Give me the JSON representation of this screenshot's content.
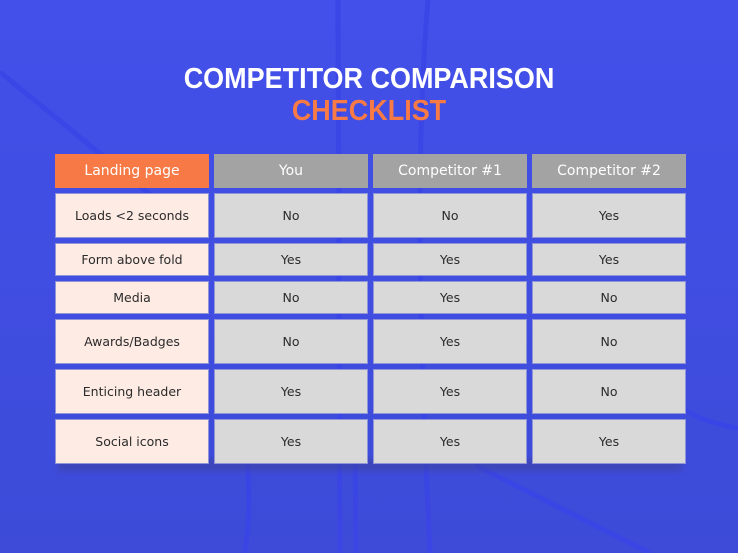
{
  "title": {
    "line1": "COMPETITOR COMPARISON",
    "line2": "CHECKLIST"
  },
  "colors": {
    "background": "#4350ea",
    "accent_orange": "#f77a46",
    "header_gray": "#a3a3a3",
    "feature_cell": "#fdebe4",
    "value_cell": "#d9d9d9"
  },
  "table": {
    "headers": [
      "Landing page",
      "You",
      "Competitor #1",
      "Competitor #2"
    ],
    "rows": [
      {
        "feature": "Loads <2 seconds",
        "values": [
          "No",
          "No",
          "Yes"
        ]
      },
      {
        "feature": "Form above fold",
        "values": [
          "Yes",
          "Yes",
          "Yes"
        ]
      },
      {
        "feature": "Media",
        "values": [
          "No",
          "Yes",
          "No"
        ]
      },
      {
        "feature": "Awards/Badges",
        "values": [
          "No",
          "Yes",
          "No"
        ]
      },
      {
        "feature": "Enticing header",
        "values": [
          "Yes",
          "Yes",
          "No"
        ]
      },
      {
        "feature": "Social icons",
        "values": [
          "Yes",
          "Yes",
          "Yes"
        ]
      }
    ]
  }
}
